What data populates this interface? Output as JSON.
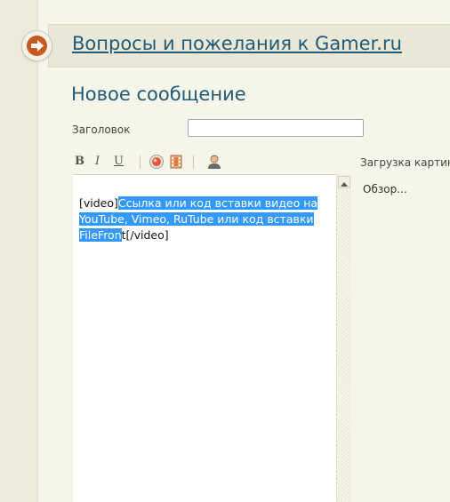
{
  "header": {
    "title": "Вопросы и пожелания к Gamer.ru"
  },
  "form": {
    "heading": "Новое сообщение",
    "title_label": "Заголовок",
    "title_value": "",
    "upload_label": "Загрузка картинок",
    "browse_label": "Обзор..."
  },
  "toolbar": {
    "bold": "B",
    "italic": "I",
    "underline": "U"
  },
  "editor": {
    "text_open_tag": "[video]",
    "selected_text": "Ссылка или код вставки видео на YouTube, Vimeo, RuTube или код вставки FileFron",
    "text_after": "t[/video]"
  },
  "colors": {
    "accent": "#1f5a78",
    "back_button": "#c85a1e",
    "selection": "#3399ff"
  }
}
